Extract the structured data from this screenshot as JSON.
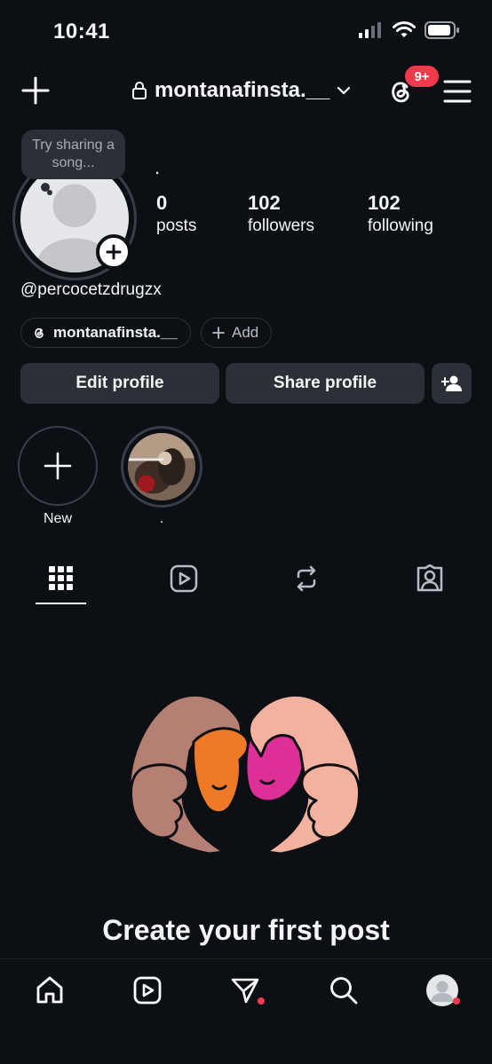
{
  "status_bar": {
    "time": "10:41",
    "icons": [
      "signal-bars-icon",
      "wifi-icon",
      "battery-icon"
    ]
  },
  "header": {
    "username": "montanafinsta.__",
    "notification_badge": "9+",
    "icons": [
      "plus-icon",
      "lock-icon",
      "chevron-down-icon",
      "threads-icon",
      "menu-icon"
    ]
  },
  "profile": {
    "note_placeholder": "Try sharing a song...",
    "display_name": ".",
    "stats": [
      {
        "value": "0",
        "label": "posts"
      },
      {
        "value": "102",
        "label": "followers"
      },
      {
        "value": "102",
        "label": "following"
      }
    ],
    "handle": "@percocetzdrugzx",
    "threads_chip": "montanafinsta.__",
    "add_chip": "Add"
  },
  "actions": {
    "edit": "Edit profile",
    "share": "Share profile"
  },
  "highlights": [
    {
      "label": "New"
    },
    {
      "label": "."
    }
  ],
  "tabs": [
    "grid-icon",
    "reels-icon",
    "reposts-icon",
    "tagged-icon"
  ],
  "empty_state": {
    "title": "Create your first post"
  },
  "bottom_nav": [
    "home-icon",
    "reels-icon",
    "messages-icon",
    "search-icon",
    "profile-avatar"
  ],
  "colors": {
    "background": "#0c0f14",
    "button": "#2b2f36",
    "badge": "#f23a4d"
  }
}
